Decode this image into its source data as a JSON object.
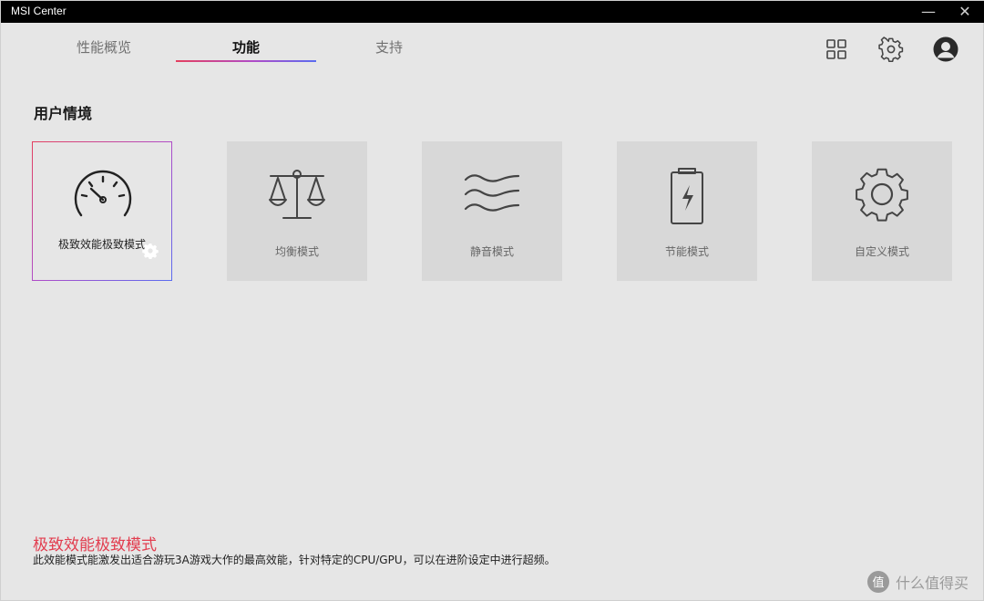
{
  "window": {
    "title": "MSI Center",
    "minimize_glyph": "—",
    "close_glyph": "✕"
  },
  "nav": {
    "tabs": [
      {
        "label": "性能概览"
      },
      {
        "label": "功能"
      },
      {
        "label": "支持"
      }
    ],
    "active_tab": 1,
    "icons": [
      "grid-icon",
      "settings-gear-icon",
      "user-avatar-icon"
    ]
  },
  "section": {
    "title": "用户情境"
  },
  "modes": [
    {
      "label": "极致效能极致模式",
      "icon": "speedometer-icon",
      "active": true
    },
    {
      "label": "均衡模式",
      "icon": "balance-scale-icon"
    },
    {
      "label": "静音模式",
      "icon": "waves-icon"
    },
    {
      "label": "节能模式",
      "icon": "battery-charging-icon"
    },
    {
      "label": "自定义模式",
      "icon": "gear-icon"
    }
  ],
  "description": {
    "title": "极致效能极致模式",
    "text": "此效能模式能激发出适合游玩3A游戏大作的最高效能，针对特定的CPU/GPU，可以在进阶设定中进行超频。"
  },
  "watermark": {
    "text": "什么值得买",
    "logo_glyph": "值"
  },
  "colors": {
    "accent_red": "#e23d4f",
    "accent_blue": "#5a6cf0",
    "card_bg": "#d8d8d8",
    "icon_stroke": "#444444"
  }
}
